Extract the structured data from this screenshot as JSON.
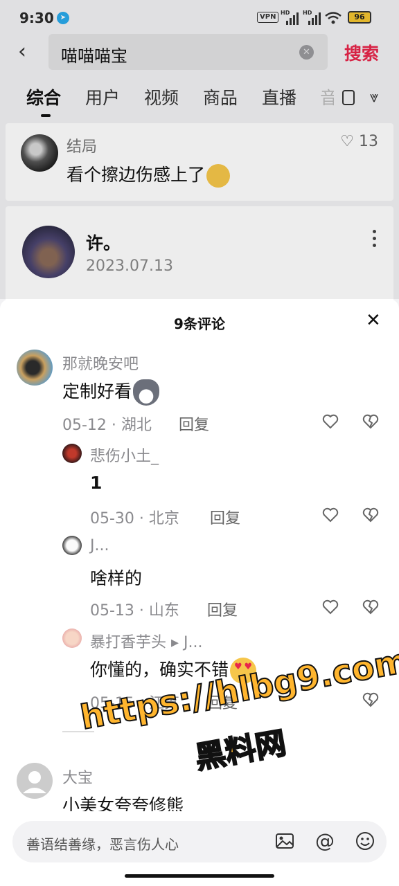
{
  "status_bar": {
    "time": "9:30",
    "vpn": "VPN",
    "hd1": "HD",
    "hd2": "HD",
    "battery": "96"
  },
  "search": {
    "query": "喵喵喵宝",
    "search_button": "搜索"
  },
  "tabs": [
    {
      "label": "综合",
      "active": true
    },
    {
      "label": "用户"
    },
    {
      "label": "视频"
    },
    {
      "label": "商品"
    },
    {
      "label": "直播"
    },
    {
      "label": "音"
    }
  ],
  "result_card_1": {
    "username": "结局",
    "text": "看个擦边伤感上了",
    "likes": "13"
  },
  "result_card_2": {
    "username": "许。",
    "date": "2023.07.13"
  },
  "comments_sheet": {
    "title": "9条评论",
    "comments": [
      {
        "user": "那就晚安吧",
        "text": "定制好看",
        "meta": "05-12 · 湖北",
        "reply": "回复"
      },
      {
        "user": "悲伤小土_",
        "text": "1",
        "meta": "05-30 · 北京",
        "reply": "回复"
      },
      {
        "user": "J...",
        "text": "啥样的",
        "meta": "05-13 · 山东",
        "reply": "回复"
      },
      {
        "user": "暴打香芋头 ▸ J...",
        "text": "你懂的，确实不错",
        "meta": "05-15 · 江苏",
        "reply": "回复"
      },
      {
        "user": "大宝",
        "text": "小美女夸夸修熊"
      }
    ]
  },
  "input": {
    "placeholder": "善语结善缘，恶言伤人心"
  },
  "watermark": {
    "line1": "https://hlbg9.com",
    "line2": "黑料网"
  },
  "colors": {
    "accent": "#e8264b",
    "watermark": "#ffb52e"
  }
}
